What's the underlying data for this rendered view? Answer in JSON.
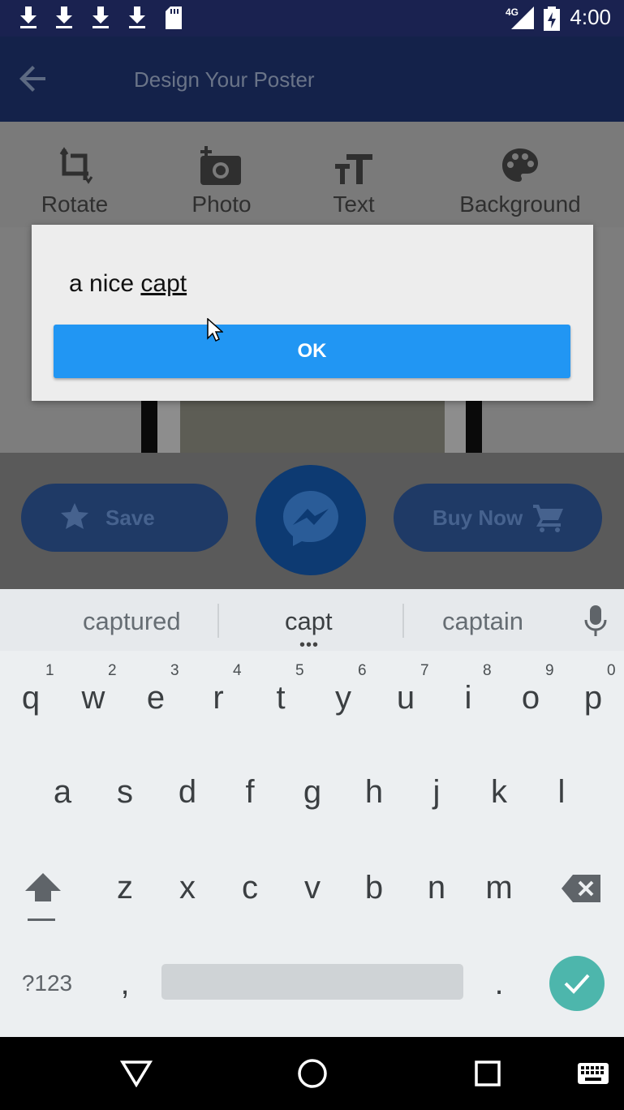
{
  "status_bar": {
    "time": "4:00",
    "network": "4G",
    "icons": [
      "download-icon",
      "download-icon",
      "download-icon",
      "download-icon",
      "sd-card-icon",
      "signal-icon",
      "battery-charging-icon"
    ]
  },
  "app_bar": {
    "title": "Design Your Poster",
    "back_icon": "arrow-back-icon"
  },
  "tools": [
    {
      "label": "Rotate",
      "icon": "crop-rotate-icon"
    },
    {
      "label": "Photo",
      "icon": "add-photo-icon"
    },
    {
      "label": "Text",
      "icon": "text-size-icon"
    },
    {
      "label": "Background",
      "icon": "palette-icon"
    }
  ],
  "actions": {
    "save_label": "Save",
    "buy_label": "Buy Now"
  },
  "dialog": {
    "text_prefix": "a nice ",
    "text_composing": "capt",
    "ok_label": "OK"
  },
  "keyboard": {
    "suggestions": [
      "captured",
      "capt",
      "captain"
    ],
    "row1": [
      {
        "key": "q",
        "hint": "1"
      },
      {
        "key": "w",
        "hint": "2"
      },
      {
        "key": "e",
        "hint": "3"
      },
      {
        "key": "r",
        "hint": "4"
      },
      {
        "key": "t",
        "hint": "5"
      },
      {
        "key": "y",
        "hint": "6"
      },
      {
        "key": "u",
        "hint": "7"
      },
      {
        "key": "i",
        "hint": "8"
      },
      {
        "key": "o",
        "hint": "9"
      },
      {
        "key": "p",
        "hint": "0"
      }
    ],
    "row2": [
      "a",
      "s",
      "d",
      "f",
      "g",
      "h",
      "j",
      "k",
      "l"
    ],
    "row3": [
      "z",
      "x",
      "c",
      "v",
      "b",
      "n",
      "m"
    ],
    "symbols_label": "?123",
    "comma": ",",
    "period": "."
  },
  "colors": {
    "status_bar": "#1a2250",
    "app_bar": "#14224a",
    "ok_button": "#2196f3",
    "enter_key": "#4db6ac",
    "keyboard_bg": "#eceff1"
  }
}
